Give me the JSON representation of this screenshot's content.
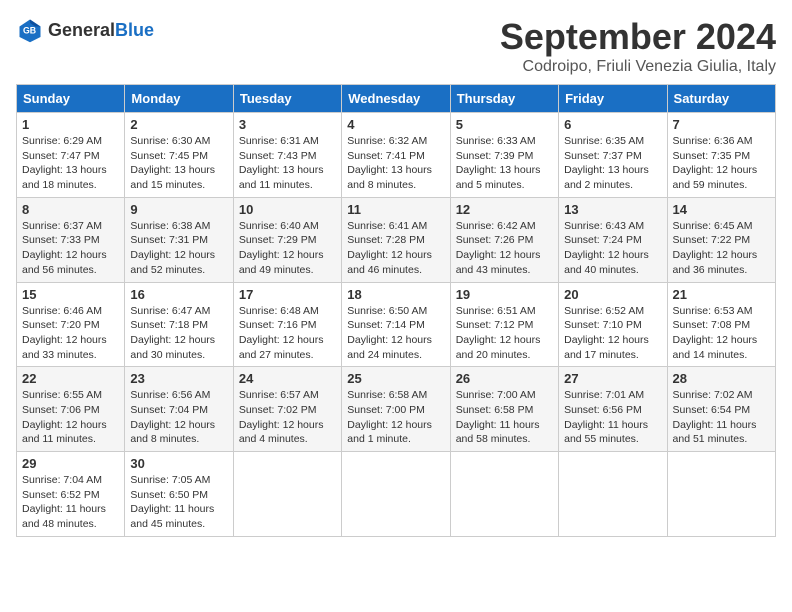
{
  "header": {
    "logo_general": "General",
    "logo_blue": "Blue",
    "month": "September 2024",
    "location": "Codroipo, Friuli Venezia Giulia, Italy"
  },
  "weekdays": [
    "Sunday",
    "Monday",
    "Tuesday",
    "Wednesday",
    "Thursday",
    "Friday",
    "Saturday"
  ],
  "weeks": [
    [
      {
        "day": "1",
        "sunrise": "6:29 AM",
        "sunset": "7:47 PM",
        "daylight": "13 hours and 18 minutes."
      },
      {
        "day": "2",
        "sunrise": "6:30 AM",
        "sunset": "7:45 PM",
        "daylight": "13 hours and 15 minutes."
      },
      {
        "day": "3",
        "sunrise": "6:31 AM",
        "sunset": "7:43 PM",
        "daylight": "13 hours and 11 minutes."
      },
      {
        "day": "4",
        "sunrise": "6:32 AM",
        "sunset": "7:41 PM",
        "daylight": "13 hours and 8 minutes."
      },
      {
        "day": "5",
        "sunrise": "6:33 AM",
        "sunset": "7:39 PM",
        "daylight": "13 hours and 5 minutes."
      },
      {
        "day": "6",
        "sunrise": "6:35 AM",
        "sunset": "7:37 PM",
        "daylight": "13 hours and 2 minutes."
      },
      {
        "day": "7",
        "sunrise": "6:36 AM",
        "sunset": "7:35 PM",
        "daylight": "12 hours and 59 minutes."
      }
    ],
    [
      {
        "day": "8",
        "sunrise": "6:37 AM",
        "sunset": "7:33 PM",
        "daylight": "12 hours and 56 minutes."
      },
      {
        "day": "9",
        "sunrise": "6:38 AM",
        "sunset": "7:31 PM",
        "daylight": "12 hours and 52 minutes."
      },
      {
        "day": "10",
        "sunrise": "6:40 AM",
        "sunset": "7:29 PM",
        "daylight": "12 hours and 49 minutes."
      },
      {
        "day": "11",
        "sunrise": "6:41 AM",
        "sunset": "7:28 PM",
        "daylight": "12 hours and 46 minutes."
      },
      {
        "day": "12",
        "sunrise": "6:42 AM",
        "sunset": "7:26 PM",
        "daylight": "12 hours and 43 minutes."
      },
      {
        "day": "13",
        "sunrise": "6:43 AM",
        "sunset": "7:24 PM",
        "daylight": "12 hours and 40 minutes."
      },
      {
        "day": "14",
        "sunrise": "6:45 AM",
        "sunset": "7:22 PM",
        "daylight": "12 hours and 36 minutes."
      }
    ],
    [
      {
        "day": "15",
        "sunrise": "6:46 AM",
        "sunset": "7:20 PM",
        "daylight": "12 hours and 33 minutes."
      },
      {
        "day": "16",
        "sunrise": "6:47 AM",
        "sunset": "7:18 PM",
        "daylight": "12 hours and 30 minutes."
      },
      {
        "day": "17",
        "sunrise": "6:48 AM",
        "sunset": "7:16 PM",
        "daylight": "12 hours and 27 minutes."
      },
      {
        "day": "18",
        "sunrise": "6:50 AM",
        "sunset": "7:14 PM",
        "daylight": "12 hours and 24 minutes."
      },
      {
        "day": "19",
        "sunrise": "6:51 AM",
        "sunset": "7:12 PM",
        "daylight": "12 hours and 20 minutes."
      },
      {
        "day": "20",
        "sunrise": "6:52 AM",
        "sunset": "7:10 PM",
        "daylight": "12 hours and 17 minutes."
      },
      {
        "day": "21",
        "sunrise": "6:53 AM",
        "sunset": "7:08 PM",
        "daylight": "12 hours and 14 minutes."
      }
    ],
    [
      {
        "day": "22",
        "sunrise": "6:55 AM",
        "sunset": "7:06 PM",
        "daylight": "12 hours and 11 minutes."
      },
      {
        "day": "23",
        "sunrise": "6:56 AM",
        "sunset": "7:04 PM",
        "daylight": "12 hours and 8 minutes."
      },
      {
        "day": "24",
        "sunrise": "6:57 AM",
        "sunset": "7:02 PM",
        "daylight": "12 hours and 4 minutes."
      },
      {
        "day": "25",
        "sunrise": "6:58 AM",
        "sunset": "7:00 PM",
        "daylight": "12 hours and 1 minute."
      },
      {
        "day": "26",
        "sunrise": "7:00 AM",
        "sunset": "6:58 PM",
        "daylight": "11 hours and 58 minutes."
      },
      {
        "day": "27",
        "sunrise": "7:01 AM",
        "sunset": "6:56 PM",
        "daylight": "11 hours and 55 minutes."
      },
      {
        "day": "28",
        "sunrise": "7:02 AM",
        "sunset": "6:54 PM",
        "daylight": "11 hours and 51 minutes."
      }
    ],
    [
      {
        "day": "29",
        "sunrise": "7:04 AM",
        "sunset": "6:52 PM",
        "daylight": "11 hours and 48 minutes."
      },
      {
        "day": "30",
        "sunrise": "7:05 AM",
        "sunset": "6:50 PM",
        "daylight": "11 hours and 45 minutes."
      },
      null,
      null,
      null,
      null,
      null
    ]
  ]
}
